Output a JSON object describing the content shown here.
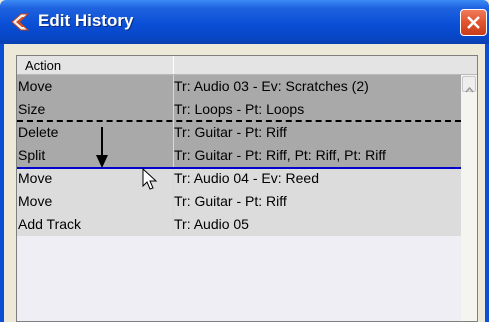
{
  "window": {
    "title": "Edit History",
    "title_bar_color": "#0a4fd6",
    "close_button_color": "#e0532d"
  },
  "list": {
    "header": {
      "column1": "Action",
      "column2": ""
    },
    "rows": [
      {
        "action": "Move",
        "detail": "Tr: Audio 03 - Ev: Scratches (2)",
        "state": "done"
      },
      {
        "action": "Size",
        "detail": "Tr: Loops - Pt: Loops",
        "state": "done"
      },
      {
        "action": "Delete",
        "detail": "Tr: Guitar - Pt: Riff",
        "state": "done"
      },
      {
        "action": "Split",
        "detail": "Tr: Guitar - Pt: Riff, Pt: Riff, Pt: Riff",
        "state": "done"
      },
      {
        "action": "Move",
        "detail": "Tr: Audio 04 - Ev: Reed",
        "state": "undone"
      },
      {
        "action": "Move",
        "detail": "Tr: Guitar - Pt: Riff",
        "state": "undone"
      },
      {
        "action": "Add Track",
        "detail": "Tr: Audio 05",
        "state": "undone"
      }
    ]
  },
  "icons": {
    "app": "cubase-logo-icon",
    "close": "close-icon",
    "scroll_up": "scroll-up-arrow-icon",
    "indicator": "down-arrow-icon",
    "cursor": "mouse-cursor-icon"
  },
  "colors": {
    "done_row": "#a9a9a9",
    "undone_row": "#dcdcdc",
    "undo_point_line": "#0000cc"
  }
}
